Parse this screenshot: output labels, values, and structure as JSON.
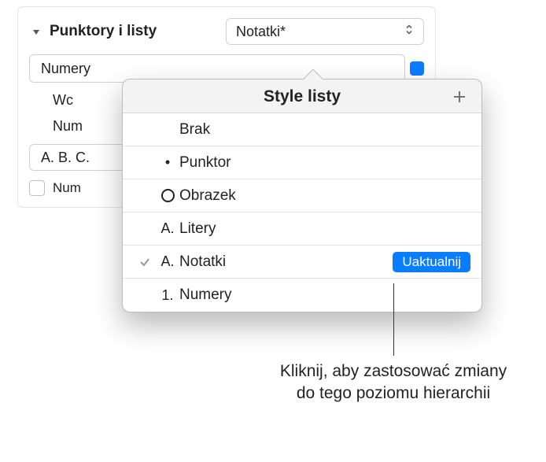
{
  "section": {
    "title": "Punktory i listy",
    "style_selected": "Notatki*"
  },
  "row2": {
    "label": "Numery"
  },
  "row3_label": "Wc",
  "row4_label": "Num",
  "row5_value": "A. B. C.",
  "row6_label": "Num",
  "popover": {
    "title": "Style listy",
    "items": [
      {
        "bullet": "",
        "label": "Brak",
        "checked": false,
        "update": false
      },
      {
        "bullet": "•",
        "label": "Punktor",
        "checked": false,
        "update": false
      },
      {
        "bullet": "○",
        "label": "Obrazek",
        "checked": false,
        "update": false
      },
      {
        "bullet": "A.",
        "label": "Litery",
        "checked": false,
        "update": false
      },
      {
        "bullet": "A.",
        "label": "Notatki",
        "checked": true,
        "update": true
      },
      {
        "bullet": "1.",
        "label": "Numery",
        "checked": false,
        "update": false
      }
    ],
    "update_label": "Uaktualnij"
  },
  "callout": "Kliknij, aby zastosować zmiany do tego poziomu hierarchii"
}
